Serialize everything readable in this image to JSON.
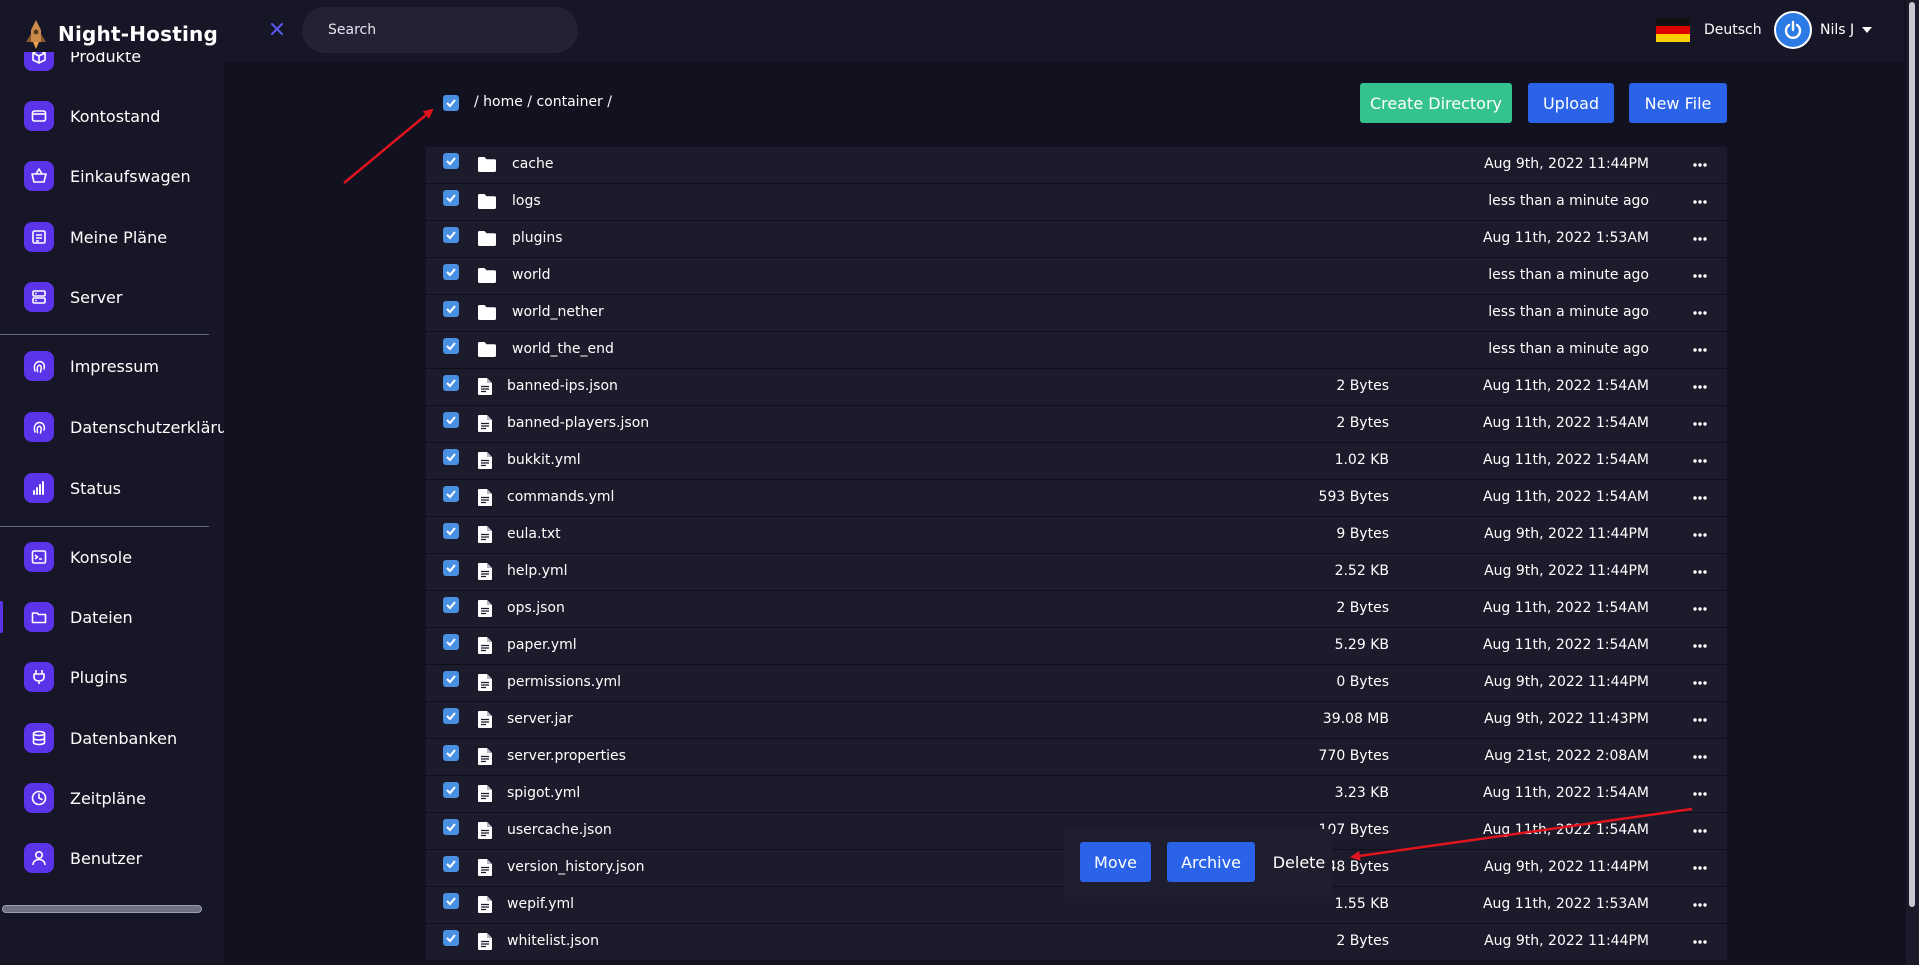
{
  "brand": {
    "name": "Night-Hosting"
  },
  "sidebar": {
    "items": [
      {
        "label": "Produkte",
        "icon": "box-icon"
      },
      {
        "label": "Kontostand",
        "icon": "wallet-icon"
      },
      {
        "label": "Einkaufswagen",
        "icon": "basket-icon"
      },
      {
        "label": "Meine Pläne",
        "icon": "plans-icon"
      },
      {
        "label": "Server",
        "icon": "server-icon"
      },
      {
        "label": "Impressum",
        "icon": "fingerprint-icon"
      },
      {
        "label": "Datenschutzerklärung",
        "icon": "fingerprint-icon"
      },
      {
        "label": "Status",
        "icon": "signal-icon"
      },
      {
        "label": "Konsole",
        "icon": "terminal-icon"
      },
      {
        "label": "Dateien",
        "icon": "folder-icon"
      },
      {
        "label": "Plugins",
        "icon": "plug-icon"
      },
      {
        "label": "Datenbanken",
        "icon": "database-icon"
      },
      {
        "label": "Zeitpläne",
        "icon": "clock-icon"
      },
      {
        "label": "Benutzer",
        "icon": "user-icon"
      }
    ]
  },
  "topbar": {
    "search_placeholder": "Search",
    "language": "Deutsch",
    "user_name": "Nils J"
  },
  "file_manager": {
    "path": "/ home / container /",
    "buttons": {
      "create_directory": "Create Directory",
      "upload": "Upload",
      "new_file": "New File"
    },
    "files": [
      {
        "type": "folder",
        "name": "cache",
        "size": "",
        "modified": "Aug 9th, 2022 11:44PM"
      },
      {
        "type": "folder",
        "name": "logs",
        "size": "",
        "modified": "less than a minute ago"
      },
      {
        "type": "folder",
        "name": "plugins",
        "size": "",
        "modified": "Aug 11th, 2022 1:53AM"
      },
      {
        "type": "folder",
        "name": "world",
        "size": "",
        "modified": "less than a minute ago"
      },
      {
        "type": "folder",
        "name": "world_nether",
        "size": "",
        "modified": "less than a minute ago"
      },
      {
        "type": "folder",
        "name": "world_the_end",
        "size": "",
        "modified": "less than a minute ago"
      },
      {
        "type": "file",
        "name": "banned-ips.json",
        "size": "2 Bytes",
        "modified": "Aug 11th, 2022 1:54AM"
      },
      {
        "type": "file",
        "name": "banned-players.json",
        "size": "2 Bytes",
        "modified": "Aug 11th, 2022 1:54AM"
      },
      {
        "type": "file",
        "name": "bukkit.yml",
        "size": "1.02 KB",
        "modified": "Aug 11th, 2022 1:54AM"
      },
      {
        "type": "file",
        "name": "commands.yml",
        "size": "593 Bytes",
        "modified": "Aug 11th, 2022 1:54AM"
      },
      {
        "type": "file",
        "name": "eula.txt",
        "size": "9 Bytes",
        "modified": "Aug 9th, 2022 11:44PM"
      },
      {
        "type": "file",
        "name": "help.yml",
        "size": "2.52 KB",
        "modified": "Aug 9th, 2022 11:44PM"
      },
      {
        "type": "file",
        "name": "ops.json",
        "size": "2 Bytes",
        "modified": "Aug 11th, 2022 1:54AM"
      },
      {
        "type": "file",
        "name": "paper.yml",
        "size": "5.29 KB",
        "modified": "Aug 11th, 2022 1:54AM"
      },
      {
        "type": "file",
        "name": "permissions.yml",
        "size": "0 Bytes",
        "modified": "Aug 9th, 2022 11:44PM"
      },
      {
        "type": "file",
        "name": "server.jar",
        "size": "39.08 MB",
        "modified": "Aug 9th, 2022 11:43PM"
      },
      {
        "type": "file",
        "name": "server.properties",
        "size": "770 Bytes",
        "modified": "Aug 21st, 2022 2:08AM"
      },
      {
        "type": "file",
        "name": "spigot.yml",
        "size": "3.23 KB",
        "modified": "Aug 11th, 2022 1:54AM"
      },
      {
        "type": "file",
        "name": "usercache.json",
        "size": "107 Bytes",
        "modified": "Aug 11th, 2022 1:54AM"
      },
      {
        "type": "file",
        "name": "version_history.json",
        "size": "48 Bytes",
        "modified": "Aug 9th, 2022 11:44PM"
      },
      {
        "type": "file",
        "name": "wepif.yml",
        "size": "1.55 KB",
        "modified": "Aug 11th, 2022 1:53AM"
      },
      {
        "type": "file",
        "name": "whitelist.json",
        "size": "2 Bytes",
        "modified": "Aug 9th, 2022 11:44PM"
      }
    ],
    "selection_actions": {
      "move": "Move",
      "archive": "Archive",
      "delete": "Delete"
    }
  },
  "colors": {
    "background": "#111120",
    "sidebar": "#161626",
    "accent_purple": "#5b34ea",
    "primary_blue": "#2b63e8",
    "success_green": "#34c38f",
    "checkbox_blue": "#4a90e2",
    "annotation_red": "#e0141c"
  }
}
